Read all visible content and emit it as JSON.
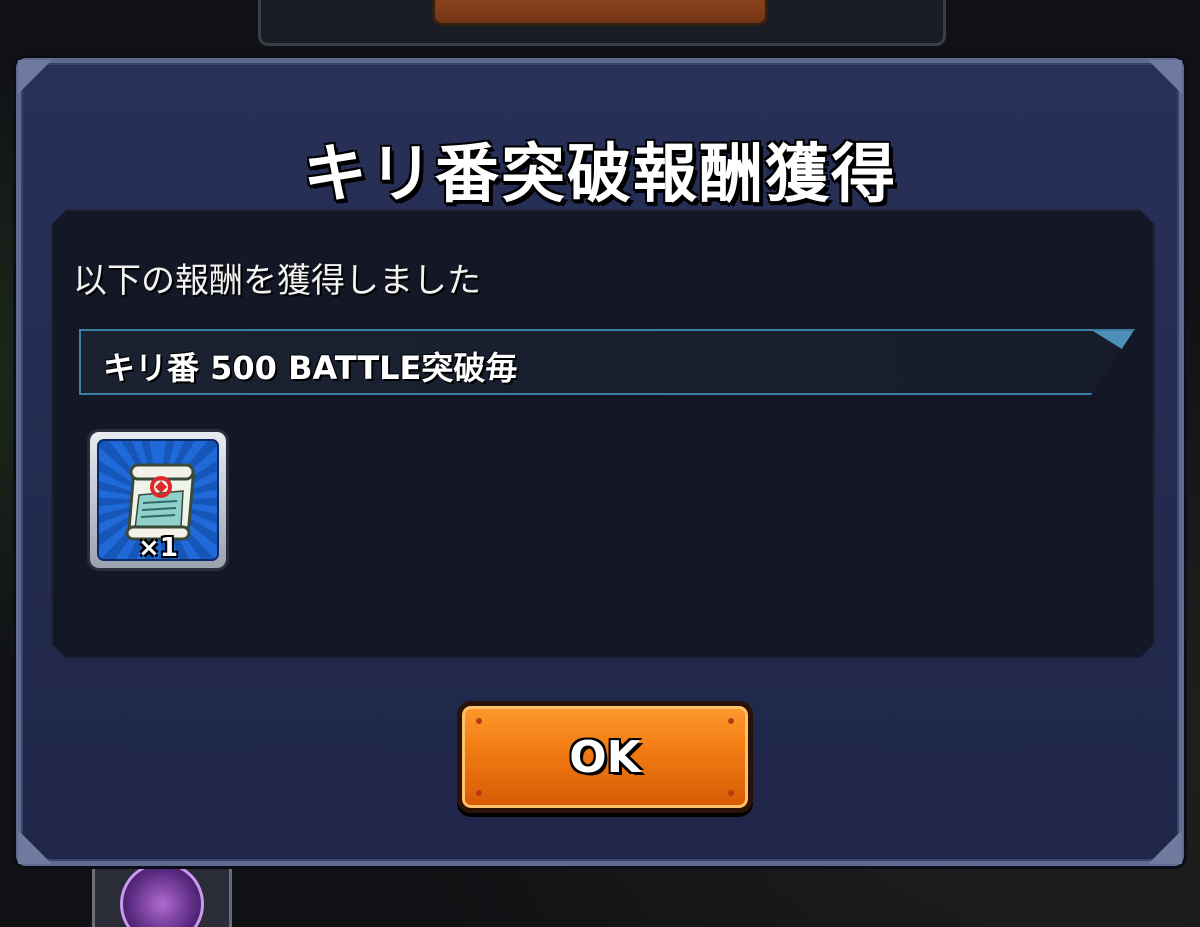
{
  "dialog": {
    "title": "キリ番突破報酬獲得",
    "description": "以下の報酬を獲得しました",
    "event_label": "キリ番 500 BATTLE突破毎",
    "reward": {
      "icon": "scroll-icon",
      "count_label": "×1"
    },
    "ok_label": "OK"
  },
  "colors": {
    "dialog_bg": "#262e56",
    "accent_button": "#f07a12",
    "event_border": "#3d7ea6",
    "reward_bg": "#1f6ad8"
  }
}
